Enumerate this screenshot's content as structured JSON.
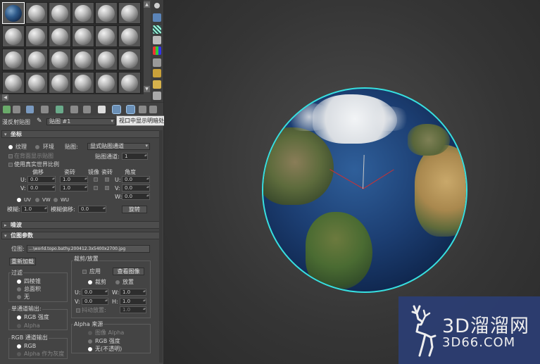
{
  "tooltip": "视口中显示明暗处理材质",
  "material_row": {
    "label": "漫反射贴图",
    "map_name": "贴图 #1"
  },
  "coordinates": {
    "title": "坐标",
    "type_texture": "纹理",
    "type_env": "环境",
    "mapping_label": "贴图:",
    "mapping_value": "显式贴图通道",
    "show_on_back": "在背面显示贴图",
    "real_world": "使用真实世界比例",
    "channel_label": "贴图通道:",
    "channel_value": "1",
    "offset_hdr": "偏移",
    "tiling_hdr": "瓷砖",
    "mirror_hdr": "镜像",
    "tile_hdr": "瓷砖",
    "angle_hdr": "角度",
    "u_label": "U:",
    "v_label": "V:",
    "w_label": "W:",
    "u_offset": "0.0",
    "v_offset": "0.0",
    "u_tiling": "1.0",
    "v_tiling": "1.0",
    "u_angle": "0.0",
    "v_angle": "0.0",
    "w_angle": "0.0",
    "uv": "UV",
    "vw": "VW",
    "wu": "WU",
    "blur_label": "模糊:",
    "blur_value": "1.0",
    "blur_offset_label": "模糊偏移:",
    "blur_offset_value": "0.0",
    "rotate_btn": "旋转"
  },
  "noise": {
    "title": "噪波"
  },
  "bitmap": {
    "title": "位图参数",
    "path_label": "位图:",
    "path_value": "...\\world.topo.bathy.200412.3x5400x2700.jpg",
    "reload_btn": "重新加载",
    "crop_title": "裁剪/放置",
    "apply": "应用",
    "view_image_btn": "查看图像",
    "crop": "裁剪",
    "place": "放置",
    "u_label": "U:",
    "v_label": "V:",
    "w_label": "W:",
    "h_label": "H:",
    "u_value": "0.0",
    "v_value": "0.0",
    "w_value": "1.0",
    "h_value": "1.0",
    "jitter": "抖动放置:",
    "jitter_value": "1.0",
    "filter_title": "过滤",
    "filter_pyramid": "四棱锥",
    "filter_summed": "总面积",
    "filter_none": "无",
    "mono_title": "单通道输出:",
    "mono_rgb": "RGB 强度",
    "mono_alpha": "Alpha",
    "rgb_title": "RGB 通道输出",
    "rgb_rgb": "RGB",
    "rgb_alpha_gray": "Alpha 作为灰度",
    "alpha_src_title": "Alpha 来源",
    "alpha_image": "图像 Alpha",
    "alpha_rgb": "RGB 强度",
    "alpha_none": "无(不透明)"
  },
  "watermark": {
    "big": "3D溜溜网",
    "small": "3D66.COM"
  },
  "colors": {
    "accent": "#37e0e0",
    "panel": "#444444",
    "viewport": "#3a3a3a",
    "watermark_bg": "#2c3e74"
  }
}
